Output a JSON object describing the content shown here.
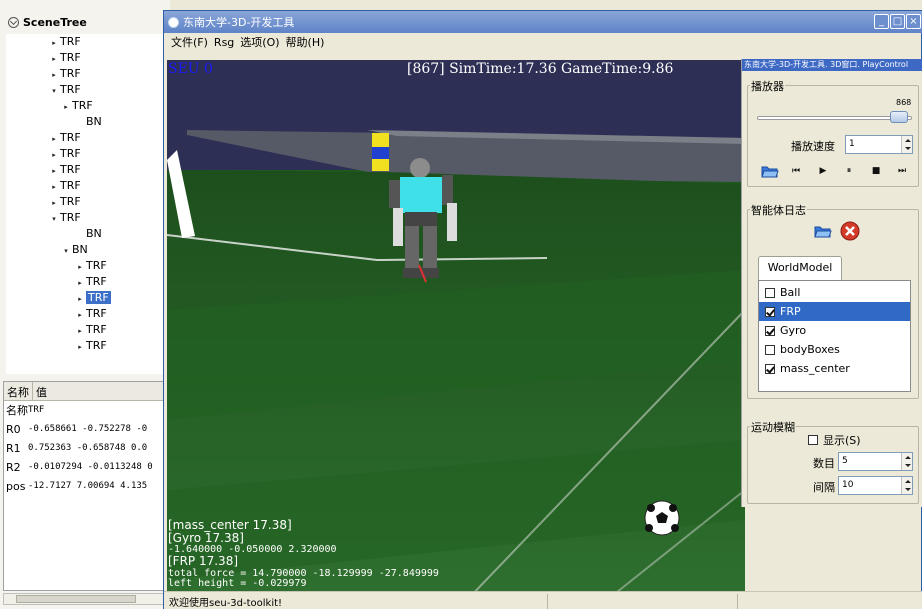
{
  "scene_tree": {
    "title": "SceneTree",
    "nodes": [
      {
        "label": "TRF",
        "twist": "▸",
        "sel": false
      },
      {
        "label": "TRF",
        "twist": "▸",
        "sel": false
      },
      {
        "label": "TRF",
        "twist": "▸",
        "sel": false
      },
      {
        "label": "TRF",
        "twist": "▾",
        "sel": false
      },
      {
        "label": "TRF",
        "twist": "▸",
        "sel": false
      },
      {
        "label": "BN",
        "twist": "",
        "sel": false
      },
      {
        "label": "TRF",
        "twist": "▸",
        "sel": false
      },
      {
        "label": "TRF",
        "twist": "▸",
        "sel": false
      },
      {
        "label": "TRF",
        "twist": "▸",
        "sel": false
      },
      {
        "label": "TRF",
        "twist": "▸",
        "sel": false
      },
      {
        "label": "TRF",
        "twist": "▸",
        "sel": false
      },
      {
        "label": "TRF",
        "twist": "▾",
        "sel": false
      },
      {
        "label": "BN",
        "twist": "",
        "sel": false
      },
      {
        "label": "BN",
        "twist": "▾",
        "sel": false
      },
      {
        "label": "TRF",
        "twist": "▸",
        "sel": false
      },
      {
        "label": "TRF",
        "twist": "▸",
        "sel": false
      },
      {
        "label": "TRF",
        "twist": "▸",
        "sel": true
      },
      {
        "label": "TRF",
        "twist": "▸",
        "sel": false
      },
      {
        "label": "TRF",
        "twist": "▸",
        "sel": false
      },
      {
        "label": "TRF",
        "twist": "▸",
        "sel": false
      }
    ]
  },
  "properties": {
    "col_name": "名称",
    "col_value": "值",
    "rows": [
      {
        "k": "名称",
        "v": "TRF"
      },
      {
        "k": "R0",
        "v": "-0.658661 -0.752278 -0"
      },
      {
        "k": "R1",
        "v": "0.752363 -0.658748 0.0"
      },
      {
        "k": "R2",
        "v": "-0.0107294 -0.0113248 0"
      },
      {
        "k": "pos",
        "v": "-12.7127 7.00694 4.135"
      }
    ]
  },
  "main_window": {
    "title": "东南大学-3D-开发工具",
    "menu": [
      "文件(F)",
      "Rsg",
      "选项(O)",
      "帮助(H)"
    ],
    "viewport": {
      "team_label": "SEU 0",
      "sim_label": "[867] SimTime:17.36 GameTime:9.86",
      "overlay_big": [
        "[mass_center 17.38]",
        "[Gyro 17.38]"
      ],
      "overlay_gyro": "-1.640000 -0.050000 2.320000",
      "overlay_frp": "[FRP 17.38]",
      "overlay_force": "total force = 14.790000 -18.129999 -27.849999",
      "overlay_height": "left height = -0.029979"
    },
    "status": "欢迎使用seu-3d-toolkit!"
  },
  "play_panel": {
    "title": "东南大学-3D-开发工具. 3D窗口. PlayControl",
    "player_group": "播放器",
    "slider_value": "868",
    "speed_label": "播放速度",
    "speed_value": "1",
    "controls": [
      "⏮",
      "▶",
      "⏸",
      "■",
      "⏭"
    ],
    "log_group": "智能体日志",
    "tab": "WorldModel",
    "items": [
      {
        "label": "Ball",
        "checked": false,
        "sel": false
      },
      {
        "label": "FRP",
        "checked": true,
        "sel": true
      },
      {
        "label": "Gyro",
        "checked": true,
        "sel": false
      },
      {
        "label": "bodyBoxes",
        "checked": false,
        "sel": false
      },
      {
        "label": "mass_center",
        "checked": true,
        "sel": false
      }
    ],
    "motion_group": "运动模糊",
    "show_label": "显示(S)",
    "count_label": "数目",
    "count_value": "5",
    "interval_label": "间隔",
    "interval_value": "10"
  },
  "colors": {
    "selection": "#3169c6",
    "titlebar": "#5e83c7",
    "field": "#1e5a1e",
    "sky": "#2d2f55"
  }
}
